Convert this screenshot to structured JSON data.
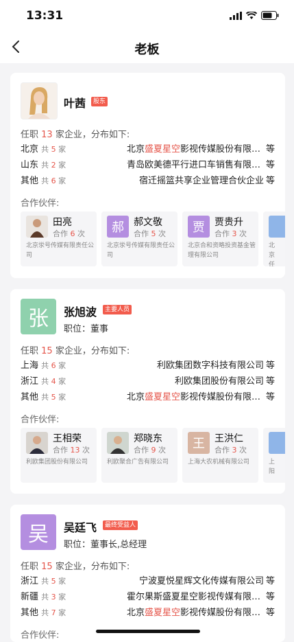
{
  "status_bar": {
    "time": "13:31"
  },
  "nav": {
    "title": "老板"
  },
  "colors": {
    "accent": "#e5554a",
    "tag": "#f25c4d"
  },
  "persons": [
    {
      "name": "叶茜",
      "tag": "股东",
      "role": "",
      "summary": {
        "pre": "任职",
        "num": "13",
        "post": "家企业，分布如下:"
      },
      "regions": [
        {
          "region": "北京",
          "count_pre": "共",
          "count": "5",
          "count_post": "家",
          "company_pre": "北京",
          "company_hl": "盛夏星空",
          "company_post": "影视传媒股份有限公司",
          "deng": "等"
        },
        {
          "region": "山东",
          "count_pre": "共",
          "count": "2",
          "count_post": "家",
          "company_pre": "青岛欧美德平行进口车销售有限公司",
          "company_hl": "",
          "company_post": "",
          "deng": "等"
        },
        {
          "region": "其他",
          "count_pre": "共",
          "count": "6",
          "count_post": "家",
          "company_pre": "宿迁摇篮共享企业管理合伙企业",
          "company_hl": "",
          "company_post": "",
          "deng": "等"
        }
      ],
      "partners_label": "合作伙伴:",
      "partners": [
        {
          "name": "田亮",
          "avatar_text": "",
          "coop_pre": "合作",
          "coop_num": "6",
          "coop_post": "次",
          "company": "北京泶号传媒有限责任公司"
        },
        {
          "name": "郝文敬",
          "avatar_text": "郝",
          "coop_pre": "合作",
          "coop_num": "5",
          "coop_post": "次",
          "company": "北京泶号传媒有限责任公司"
        },
        {
          "name": "贾贵升",
          "avatar_text": "贾",
          "coop_pre": "合作",
          "coop_num": "3",
          "coop_post": "次",
          "company": "北京合和资略投资基金管理有限公司"
        },
        {
          "name": "",
          "avatar_text": "",
          "coop_pre": "",
          "coop_num": "",
          "coop_post": "",
          "company": "北京任"
        }
      ]
    },
    {
      "name": "张旭波",
      "avatar_text": "张",
      "tag": "主要人员",
      "role": "职位：董事",
      "summary": {
        "pre": "任职",
        "num": "15",
        "post": "家企业，分布如下:"
      },
      "regions": [
        {
          "region": "上海",
          "count_pre": "共",
          "count": "6",
          "count_post": "家",
          "company_pre": "利欧集团数字科技有限公司",
          "company_hl": "",
          "company_post": "",
          "deng": "等"
        },
        {
          "region": "浙江",
          "count_pre": "共",
          "count": "4",
          "count_post": "家",
          "company_pre": "利欧集团股份有限公司",
          "company_hl": "",
          "company_post": "",
          "deng": "等"
        },
        {
          "region": "其他",
          "count_pre": "共",
          "count": "5",
          "count_post": "家",
          "company_pre": "北京",
          "company_hl": "盛夏星空",
          "company_post": "影视传媒股份有限公司",
          "deng": "等"
        }
      ],
      "partners_label": "合作伙伴:",
      "partners": [
        {
          "name": "王相荣",
          "avatar_text": "",
          "coop_pre": "合作",
          "coop_num": "13",
          "coop_post": "次",
          "company": "利欧集团股份有限公司"
        },
        {
          "name": "郑晓东",
          "avatar_text": "",
          "coop_pre": "合作",
          "coop_num": "9",
          "coop_post": "次",
          "company": "利欧聚合广告有限公司"
        },
        {
          "name": "王洪仁",
          "avatar_text": "王",
          "coop_pre": "合作",
          "coop_num": "3",
          "coop_post": "次",
          "company": "上海大农机械有限公司"
        },
        {
          "name": "",
          "avatar_text": "",
          "coop_pre": "",
          "coop_num": "",
          "coop_post": "",
          "company": "上阳"
        }
      ]
    },
    {
      "name": "吴廷飞",
      "avatar_text": "吴",
      "tag": "最终受益人",
      "role": "职位：董事长,总经理",
      "summary": {
        "pre": "任职",
        "num": "15",
        "post": "家企业，分布如下:"
      },
      "regions": [
        {
          "region": "浙江",
          "count_pre": "共",
          "count": "5",
          "count_post": "家",
          "company_pre": "宁波夏悦星辉文化传媒有限公司",
          "company_hl": "",
          "company_post": "",
          "deng": "等"
        },
        {
          "region": "新疆",
          "count_pre": "共",
          "count": "3",
          "count_post": "家",
          "company_pre": "霍尔果斯盛夏星空影视传媒有限公司",
          "company_hl": "",
          "company_post": "",
          "deng": "等"
        },
        {
          "region": "其他",
          "count_pre": "共",
          "count": "7",
          "count_post": "家",
          "company_pre": "北京",
          "company_hl": "盛夏星空",
          "company_post": "影视传媒股份有限公司",
          "deng": "等"
        }
      ],
      "partners_label": "合作伙伴:"
    }
  ]
}
